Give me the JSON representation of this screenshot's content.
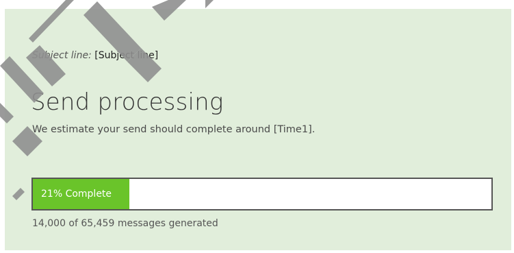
{
  "subject": {
    "label": "Subject line:",
    "value": "[Subject line]"
  },
  "status": {
    "title": "Send processing",
    "estimate": "We estimate your send should complete around [Time1]."
  },
  "progress": {
    "percent": 21,
    "label": "21% Complete",
    "count_text": "14,000 of 65,459 messages generated"
  },
  "colors": {
    "panel_background": "#e1eedb",
    "progress_fill": "#6ac42a",
    "progress_border": "#555555"
  }
}
